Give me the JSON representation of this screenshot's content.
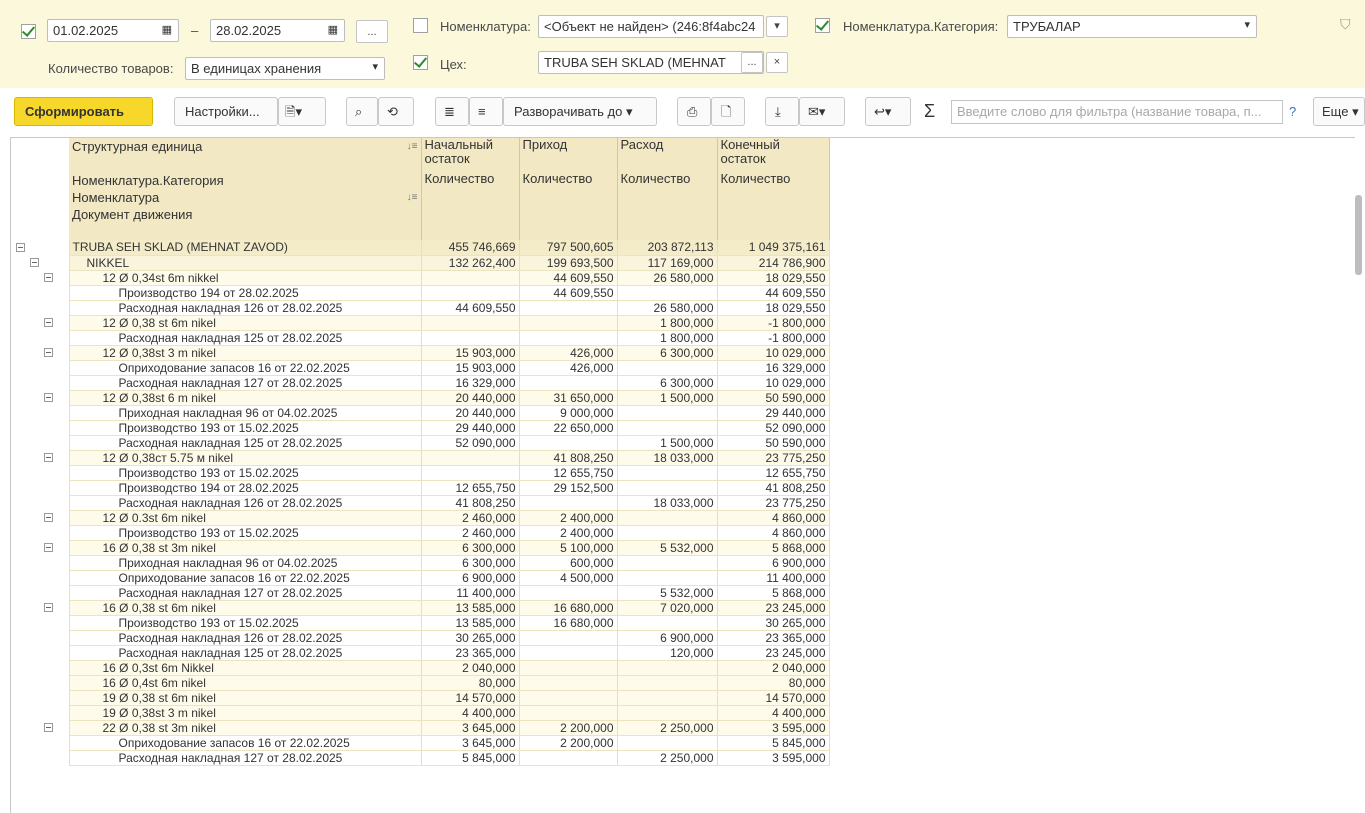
{
  "filters": {
    "date_from": "01.02.2025",
    "date_dash": "–",
    "date_to": "28.02.2025",
    "ellipsis": "...",
    "nomenclature_label": "Номенклатура:",
    "nomenclature_value": "<Объект не найден> (246:8f4abc24",
    "category_label": "Номенклатура.Категория:",
    "category_value": "ТРУБАЛАР",
    "qty_label": "Количество товаров:",
    "qty_value": "В единицах хранения",
    "shop_label": "Цех:",
    "shop_value": "TRUBA SEH SKLAD (MEHNAT",
    "shop_dots": "...",
    "clear": "×"
  },
  "toolbar": {
    "generate": "Сформировать",
    "settings": "Настройки...",
    "expand": "Разворачивать до",
    "search_placeholder": "Введите слово для фильтра (название товара, п...",
    "help": "?",
    "more": "Еще"
  },
  "table": {
    "header": {
      "col1": "Структурная единица",
      "col2": "Начальный остаток",
      "col3": "Приход",
      "col4": "Расход",
      "col5": "Конечный остаток",
      "sub1": "Номенклатура.Категория",
      "sub2": "Количество",
      "sub3": "Количество",
      "sub4": "Количество",
      "sub5": "Количество",
      "nom": "Номенклатура",
      "doc": "Документ движения"
    },
    "rows": [
      {
        "name": "TRUBA SEH SKLAD (MEHNAT ZAVOD)",
        "open": "455 746,669",
        "in": "797 500,605",
        "out": "203 872,113",
        "close": "1 049 375,161",
        "level": 0
      },
      {
        "name": "NIKKEL",
        "open": "132 262,400",
        "in": "199 693,500",
        "out": "117 169,000",
        "close": "214 786,900",
        "level": 1
      },
      {
        "name": "12 Ø 0,34st 6m nikkel",
        "open": "",
        "in": "44 609,550",
        "out": "26 580,000",
        "close": "18 029,550",
        "level": 2
      },
      {
        "name": "Производство 194 от 28.02.2025",
        "open": "",
        "in": "44 609,550",
        "out": "",
        "close": "44 609,550",
        "level": 3
      },
      {
        "name": "Расходная накладная 126 от 28.02.2025",
        "open": "44 609,550",
        "in": "",
        "out": "26 580,000",
        "close": "18 029,550",
        "level": 3
      },
      {
        "name": "12 Ø 0,38 st 6m nikel",
        "open": "",
        "in": "",
        "out": "1 800,000",
        "close": "-1 800,000",
        "level": 2
      },
      {
        "name": "Расходная накладная 125 от 28.02.2025",
        "open": "",
        "in": "",
        "out": "1 800,000",
        "close": "-1 800,000",
        "level": 3
      },
      {
        "name": "12 Ø 0,38st 3 m nikel",
        "open": "15 903,000",
        "in": "426,000",
        "out": "6 300,000",
        "close": "10 029,000",
        "level": 2
      },
      {
        "name": "Оприходование запасов 16 от 22.02.2025",
        "open": "15 903,000",
        "in": "426,000",
        "out": "",
        "close": "16 329,000",
        "level": 3
      },
      {
        "name": "Расходная накладная 127 от 28.02.2025",
        "open": "16 329,000",
        "in": "",
        "out": "6 300,000",
        "close": "10 029,000",
        "level": 3
      },
      {
        "name": "12 Ø 0,38st 6 m nikel",
        "open": "20 440,000",
        "in": "31 650,000",
        "out": "1 500,000",
        "close": "50 590,000",
        "level": 2
      },
      {
        "name": "Приходная накладная 96 от 04.02.2025",
        "open": "20 440,000",
        "in": "9 000,000",
        "out": "",
        "close": "29 440,000",
        "level": 3
      },
      {
        "name": "Производство 193 от 15.02.2025",
        "open": "29 440,000",
        "in": "22 650,000",
        "out": "",
        "close": "52 090,000",
        "level": 3
      },
      {
        "name": "Расходная накладная 125 от 28.02.2025",
        "open": "52 090,000",
        "in": "",
        "out": "1 500,000",
        "close": "50 590,000",
        "level": 3
      },
      {
        "name": "12 Ø 0,38ст 5.75 м nikel",
        "open": "",
        "in": "41 808,250",
        "out": "18 033,000",
        "close": "23 775,250",
        "level": 2
      },
      {
        "name": "Производство 193 от 15.02.2025",
        "open": "",
        "in": "12 655,750",
        "out": "",
        "close": "12 655,750",
        "level": 3
      },
      {
        "name": "Производство 194 от 28.02.2025",
        "open": "12 655,750",
        "in": "29 152,500",
        "out": "",
        "close": "41 808,250",
        "level": 3
      },
      {
        "name": "Расходная накладная 126 от 28.02.2025",
        "open": "41 808,250",
        "in": "",
        "out": "18 033,000",
        "close": "23 775,250",
        "level": 3
      },
      {
        "name": "12 Ø 0.3st 6m nikel",
        "open": "2 460,000",
        "in": "2 400,000",
        "out": "",
        "close": "4 860,000",
        "level": 2
      },
      {
        "name": "Производство 193 от 15.02.2025",
        "open": "2 460,000",
        "in": "2 400,000",
        "out": "",
        "close": "4 860,000",
        "level": 3
      },
      {
        "name": "16 Ø 0,38 st 3m nikel",
        "open": "6 300,000",
        "in": "5 100,000",
        "out": "5 532,000",
        "close": "5 868,000",
        "level": 2
      },
      {
        "name": "Приходная накладная 96 от 04.02.2025",
        "open": "6 300,000",
        "in": "600,000",
        "out": "",
        "close": "6 900,000",
        "level": 3
      },
      {
        "name": "Оприходование запасов 16 от 22.02.2025",
        "open": "6 900,000",
        "in": "4 500,000",
        "out": "",
        "close": "11 400,000",
        "level": 3
      },
      {
        "name": "Расходная накладная 127 от 28.02.2025",
        "open": "11 400,000",
        "in": "",
        "out": "5 532,000",
        "close": "5 868,000",
        "level": 3
      },
      {
        "name": "16 Ø 0,38 st 6m nikel",
        "open": "13 585,000",
        "in": "16 680,000",
        "out": "7 020,000",
        "close": "23 245,000",
        "level": 2
      },
      {
        "name": "Производство 193 от 15.02.2025",
        "open": "13 585,000",
        "in": "16 680,000",
        "out": "",
        "close": "30 265,000",
        "level": 3
      },
      {
        "name": "Расходная накладная 126 от 28.02.2025",
        "open": "30 265,000",
        "in": "",
        "out": "6 900,000",
        "close": "23 365,000",
        "level": 3
      },
      {
        "name": "Расходная накладная 125 от 28.02.2025",
        "open": "23 365,000",
        "in": "",
        "out": "120,000",
        "close": "23 245,000",
        "level": 3
      },
      {
        "name": "16 Ø 0,3st 6m Nikkel",
        "open": "2 040,000",
        "in": "",
        "out": "",
        "close": "2 040,000",
        "level": 2
      },
      {
        "name": "16 Ø 0,4st 6m nikel",
        "open": "80,000",
        "in": "",
        "out": "",
        "close": "80,000",
        "level": 2
      },
      {
        "name": "19 Ø 0,38 st 6m nikel",
        "open": "14 570,000",
        "in": "",
        "out": "",
        "close": "14 570,000",
        "level": 2
      },
      {
        "name": "19 Ø 0,38st 3 m nikel",
        "open": "4 400,000",
        "in": "",
        "out": "",
        "close": "4 400,000",
        "level": 2
      },
      {
        "name": "22 Ø 0,38 st 3m nikel",
        "open": "3 645,000",
        "in": "2 200,000",
        "out": "2 250,000",
        "close": "3 595,000",
        "level": 2
      },
      {
        "name": "Оприходование запасов 16 от 22.02.2025",
        "open": "3 645,000",
        "in": "2 200,000",
        "out": "",
        "close": "5 845,000",
        "level": 3
      },
      {
        "name": "Расходная накладная 127 от 28.02.2025",
        "open": "5 845,000",
        "in": "",
        "out": "2 250,000",
        "close": "3 595,000",
        "level": 3
      }
    ]
  }
}
